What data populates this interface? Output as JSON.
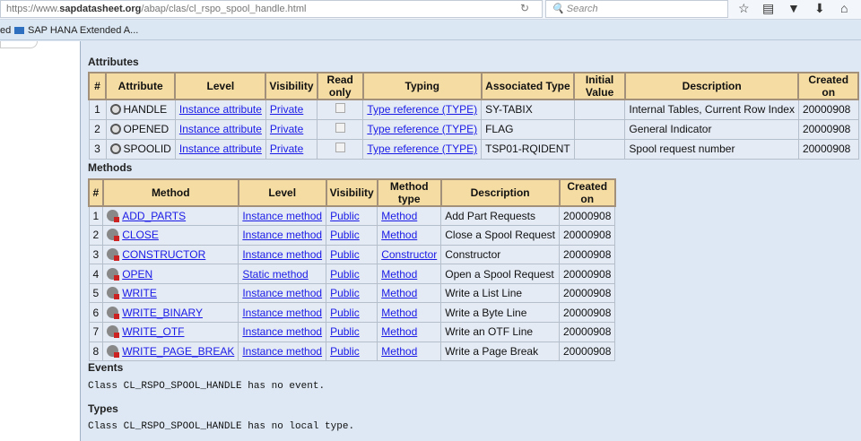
{
  "browser": {
    "url_prefix": "https://www.",
    "url_domain": "sapdatasheet.org",
    "url_path": "/abap/clas/cl_rspo_spool_handle.html",
    "search_placeholder": "Search",
    "bookmark_partial": "ed",
    "bookmark": "SAP HANA Extended A..."
  },
  "attributes": {
    "title": "Attributes",
    "headers": [
      "#",
      "Attribute",
      "Level",
      "Visibility",
      "Read only",
      "Typing",
      "Associated Type",
      "Initial Value",
      "Description",
      "Created on"
    ],
    "rows": [
      {
        "n": "1",
        "name": "HANDLE",
        "level": "Instance attribute",
        "visibility": "Private",
        "read_only": false,
        "typing": "Type reference (TYPE)",
        "assoc": "SY-TABIX",
        "initial": "",
        "desc": "Internal Tables, Current Row Index",
        "created": "20000908"
      },
      {
        "n": "2",
        "name": "OPENED",
        "level": "Instance attribute",
        "visibility": "Private",
        "read_only": false,
        "typing": "Type reference (TYPE)",
        "assoc": "FLAG",
        "initial": "",
        "desc": "General Indicator",
        "created": "20000908"
      },
      {
        "n": "3",
        "name": "SPOOLID",
        "level": "Instance attribute",
        "visibility": "Private",
        "read_only": false,
        "typing": "Type reference (TYPE)",
        "assoc": "TSP01-RQIDENT",
        "initial": "",
        "desc": "Spool request number",
        "created": "20000908"
      }
    ]
  },
  "methods": {
    "title": "Methods",
    "headers": [
      "#",
      "Method",
      "Level",
      "Visibility",
      "Method type",
      "Description",
      "Created on"
    ],
    "rows": [
      {
        "n": "1",
        "name": "ADD_PARTS",
        "level": "Instance method",
        "visibility": "Public",
        "type": "Method",
        "desc": "Add Part Requests",
        "created": "20000908"
      },
      {
        "n": "2",
        "name": "CLOSE",
        "level": "Instance method",
        "visibility": "Public",
        "type": "Method",
        "desc": "Close a Spool Request",
        "created": "20000908"
      },
      {
        "n": "3",
        "name": "CONSTRUCTOR",
        "level": "Instance method",
        "visibility": "Public",
        "type": "Constructor",
        "desc": "Constructor",
        "created": "20000908"
      },
      {
        "n": "4",
        "name": "OPEN",
        "level": "Static method",
        "visibility": "Public",
        "type": "Method",
        "desc": "Open a Spool Request",
        "created": "20000908"
      },
      {
        "n": "5",
        "name": "WRITE",
        "level": "Instance method",
        "visibility": "Public",
        "type": "Method",
        "desc": "Write a List Line",
        "created": "20000908"
      },
      {
        "n": "6",
        "name": "WRITE_BINARY",
        "level": "Instance method",
        "visibility": "Public",
        "type": "Method",
        "desc": "Write a Byte Line",
        "created": "20000908"
      },
      {
        "n": "7",
        "name": "WRITE_OTF",
        "level": "Instance method",
        "visibility": "Public",
        "type": "Method",
        "desc": "Write an OTF Line",
        "created": "20000908"
      },
      {
        "n": "8",
        "name": "WRITE_PAGE_BREAK",
        "level": "Instance method",
        "visibility": "Public",
        "type": "Method",
        "desc": "Write a Page Break",
        "created": "20000908"
      }
    ]
  },
  "events": {
    "title": "Events",
    "text": "Class CL_RSPO_SPOOL_HANDLE has no event."
  },
  "types": {
    "title": "Types",
    "text": "Class CL_RSPO_SPOOL_HANDLE has no local type."
  }
}
